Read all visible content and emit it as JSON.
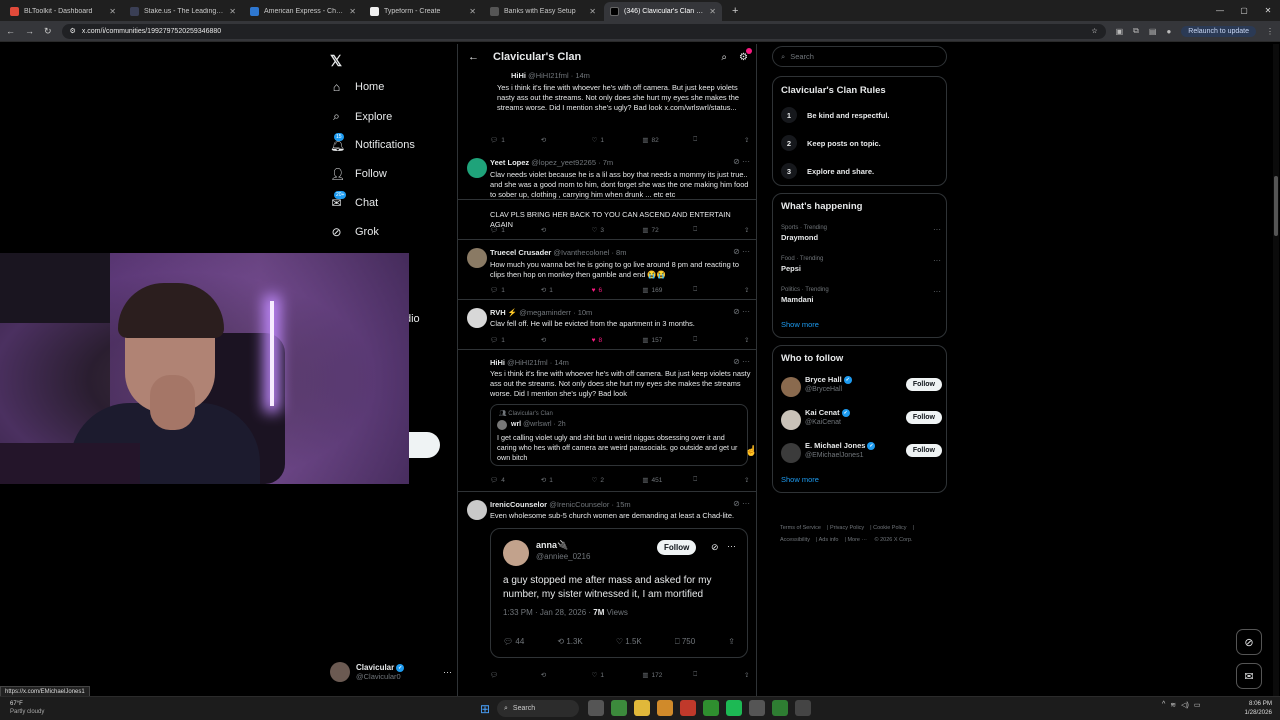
{
  "browser": {
    "tabs": [
      {
        "title": "BLToolkit - Dashboard",
        "color": "#e04a3a"
      },
      {
        "title": "Stake.us - The Leading Social C",
        "color": "#3a3f55"
      },
      {
        "title": "American Express - Charge Ver",
        "color": "#2e77d0"
      },
      {
        "title": "Typeform - Create",
        "color": "#f0f0f0"
      },
      {
        "title": "Banks with Easy Setup",
        "color": "#555"
      },
      {
        "title": "(346) Clavicular's Clan Commu",
        "color": "#000"
      }
    ],
    "url": "x.com/i/communities/1992797520259346880",
    "relaunch_label": "Relaunch to update"
  },
  "nav": {
    "home": "Home",
    "explore": "Explore",
    "notifications": "Notifications",
    "notifications_badge": "15",
    "follow": "Follow",
    "chat": "Chat",
    "chat_badge": "20+",
    "grok": "Grok",
    "partial_item": "dio"
  },
  "account": {
    "name": "Clavicular",
    "handle": "@Clavicular0"
  },
  "column": {
    "title": "Clavicular's Clan"
  },
  "posts": [
    {
      "name": "HiHi",
      "handle": "@HiHI21fml",
      "time": "14m",
      "text": "Yes i think it's fine with whoever he's with off camera. But just keep violets nasty ass out the streams. Not only does she hurt my eyes she makes the streams worse. Did I mention she's ugly? Bad look x.com/wrlswrl/status...",
      "replies": "1",
      "reposts": "",
      "likes": "1",
      "views": "82"
    },
    {
      "name": "Yeet Lopez",
      "handle": "@lopez_yeet92265",
      "time": "7m",
      "text": "Clav needs violet because he is a lil ass boy that needs a mommy its just true.. and she was a good mom to him, dont forget she was the one making him food to sober up, clothing , carrying him when drunk ... etc etc",
      "text2": "CLAV PLS BRING HER BACK TO YOU CAN ASCEND AND ENTERTAIN AGAIN",
      "replies": "1",
      "reposts": "",
      "likes": "3",
      "views": "72"
    },
    {
      "name": "Truecel Crusader",
      "handle": "@Ivanthecolonel",
      "time": "8m",
      "text": "How much you wanna bet he is going to go live around 8 pm and reacting to clips then hop on monkey then gamble and end 😭😭",
      "replies": "1",
      "reposts": "1",
      "likes": "6",
      "views": "169"
    },
    {
      "name": "RVH ⚡",
      "handle": "@megaminderr",
      "time": "10m",
      "text": "Clav fell off. He will be evicted from the apartment in 3 months.",
      "replies": "1",
      "reposts": "",
      "likes": "8",
      "views": "157"
    },
    {
      "name": "HiHi",
      "handle": "@HiHI21fml",
      "time": "14m",
      "text": "Yes i think it's fine with whoever he's with off camera. But just keep violets nasty ass out the streams. Not only does she hurt my eyes she makes the streams worse. Did I mention she's ugly? Bad look",
      "quote_community": "Clavicular's Clan",
      "quote_name": "wrl",
      "quote_handle": "@wrlswrl",
      "quote_time": "2h",
      "quote_text": "I get calling violet ugly and shit but u weird niggas obsessing over it and caring who hes with off camera are weird parasocials. go outside and get ur own bitch",
      "replies": "4",
      "reposts": "1",
      "likes": "2",
      "views": "451"
    },
    {
      "name": "IrenicCounselor",
      "handle": "@IrenicCounselor",
      "time": "15m",
      "text": "Even wholesome sub-5 church women are demanding at least a Chad-lite.",
      "embed": {
        "name": "anna🔌",
        "handle": "@anniee_0216",
        "follow": "Follow",
        "text": "a guy stopped me after mass and asked for my number, my sister witnessed it, I am mortified",
        "time": "1:33 PM · Jan 28, 2026 ·",
        "views": "7M",
        "views_label": "Views",
        "replies": "44",
        "reposts": "1.3K",
        "likes": "1.5K",
        "bookmarks": "750"
      },
      "replies": "",
      "reposts": "",
      "likes": "1",
      "views": "172"
    }
  ],
  "search": {
    "placeholder": "Search"
  },
  "rules": {
    "title": "Clavicular's Clan Rules",
    "items": [
      "Be kind and respectful.",
      "Keep posts on topic.",
      "Explore and share."
    ]
  },
  "happening": {
    "title": "What's happening",
    "trends": [
      {
        "cat": "Sports · Trending",
        "name": "Draymond"
      },
      {
        "cat": "Food · Trending",
        "name": "Pepsi"
      },
      {
        "cat": "Politics · Trending",
        "name": "Mamdani"
      }
    ],
    "show_more": "Show more"
  },
  "who_to_follow": {
    "title": "Who to follow",
    "users": [
      {
        "name": "Bryce Hall",
        "handle": "@BryceHall",
        "button": "Follow",
        "color": "#8a6a4e"
      },
      {
        "name": "Kai Cenat",
        "handle": "@KaiCenat",
        "button": "Follow",
        "color": "#c9c2b8"
      },
      {
        "name": "E. Michael Jones",
        "handle": "@EMichaelJones1",
        "button": "Follow",
        "color": "#3b3b3b"
      }
    ],
    "show_more": "Show more"
  },
  "footer": [
    "Terms of Service",
    "Privacy Policy",
    "Cookie Policy",
    "Accessibility",
    "Ads info",
    "More ···",
    "© 2026 X Corp."
  ],
  "status_url": "https://x.com/EMichaelJones1",
  "taskbar": {
    "temp": "67°F",
    "weather": "Partly cloudy",
    "search": "Search",
    "time": "8:06 PM",
    "date": "1/28/2026"
  }
}
